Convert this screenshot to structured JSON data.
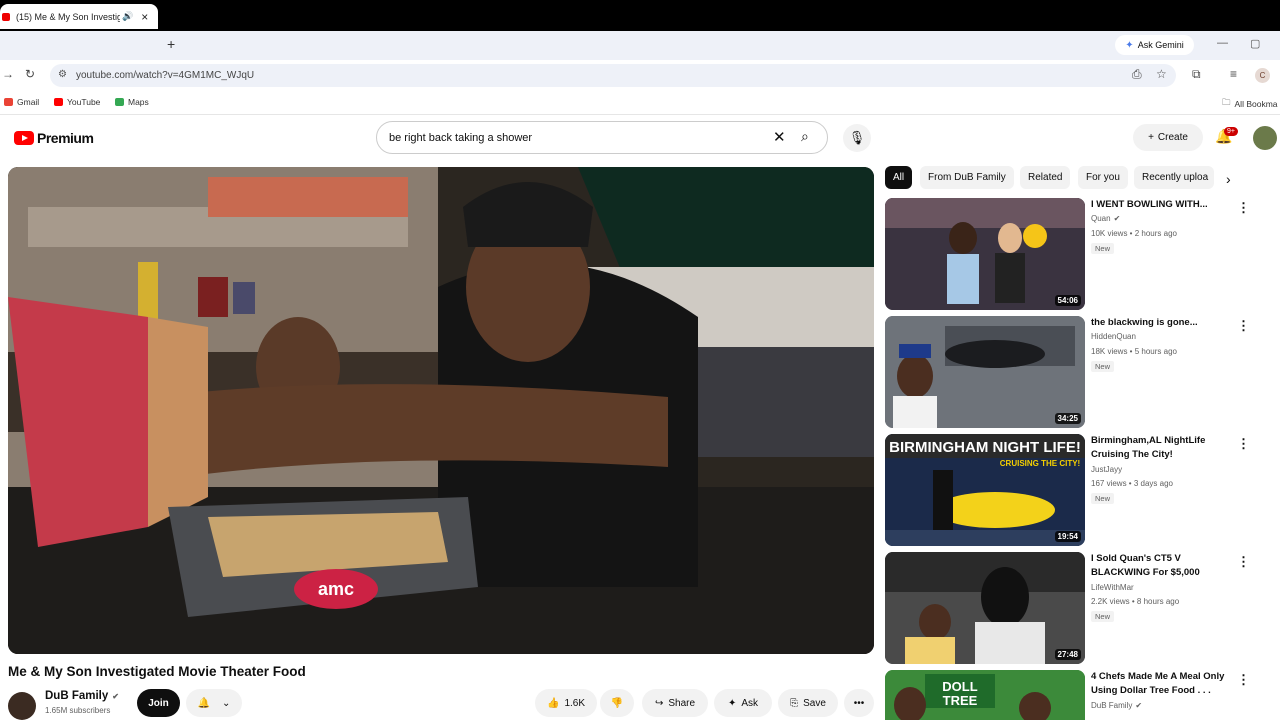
{
  "browser": {
    "tab_title": "(15) Me & My Son Investig",
    "ask_gemini": "Ask Gemini",
    "url": "youtube.com/watch?v=4GM1MC_WJqU",
    "profile_initial": "C",
    "bookmarks": [
      {
        "label": "Gmail",
        "color": "#ea4335"
      },
      {
        "label": "YouTube",
        "color": "#ff0000"
      },
      {
        "label": "Maps",
        "color": "#34a853"
      }
    ],
    "all_bookmarks": "All Bookma"
  },
  "youtube": {
    "logo": "Premium",
    "search_value": "be right back taking a shower",
    "create_label": "Create",
    "notification_count": "9+"
  },
  "video": {
    "title": "Me & My Son Investigated Movie Theater Food",
    "channel": "DuB Family",
    "subscribers": "1.65M subscribers",
    "join_label": "Join",
    "likes": "1.6K",
    "share_label": "Share",
    "ask_label": "Ask",
    "save_label": "Save",
    "box_text": "amc"
  },
  "chips": [
    "All",
    "From DuB Family",
    "Related",
    "For you",
    "Recently uploa"
  ],
  "recommendations": [
    {
      "title": "I WENT BOWLING WITH...",
      "channel": "Quan",
      "verified": true,
      "meta": "10K views • 2 hours ago",
      "new": "New",
      "duration": "54:06",
      "thumb_color": "#3a3340"
    },
    {
      "title": "the blackwing is gone...",
      "channel": "HiddenQuan",
      "verified": false,
      "meta": "18K views • 5 hours ago",
      "new": "New",
      "duration": "34:25",
      "thumb_color": "#5a5f66"
    },
    {
      "title": "Birmingham,AL NightLife Cruising The City!",
      "channel": "JustJayy",
      "verified": false,
      "meta": "167 views • 3 days ago",
      "new": "New",
      "duration": "19:54",
      "thumb_color": "#1b2a4a",
      "overlay_main": "BIRMINGHAM NIGHT LIFE!",
      "overlay_sub": "CRUISING THE CITY!"
    },
    {
      "title": "I Sold Quan's CT5 V BLACKWING For $5,000",
      "channel": "LifeWithMar",
      "verified": false,
      "meta": "2.2K views • 8 hours ago",
      "new": "New",
      "duration": "27:48",
      "thumb_color": "#4a4a4a"
    },
    {
      "title": "4 Chefs Made Me A Meal Only Using Dollar Tree Food . . .",
      "channel": "DuB Family",
      "verified": true,
      "meta": "",
      "new": "",
      "duration": "",
      "thumb_color": "#3c8a3a",
      "overlay_main": "DOLL",
      "overlay_sub": "TREE"
    }
  ]
}
